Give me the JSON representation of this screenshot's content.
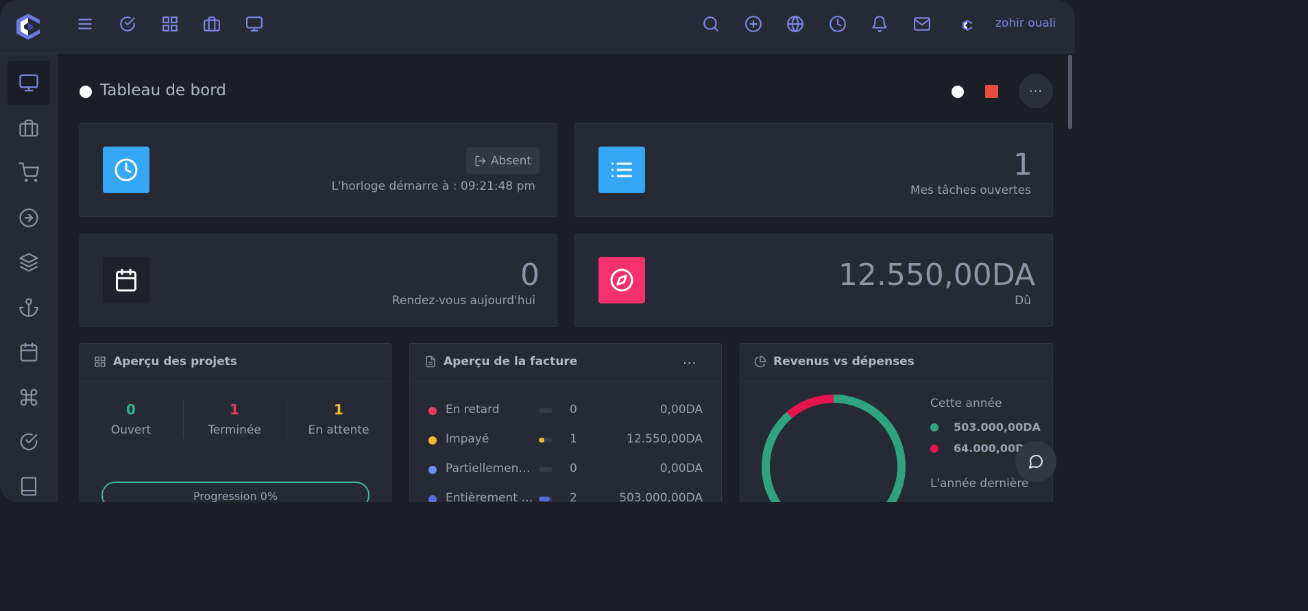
{
  "topbar": {
    "icons_left": [
      "menu-icon",
      "check-circle-icon",
      "grid-icon",
      "briefcase-icon",
      "monitor-icon"
    ],
    "icons_right": [
      "search-icon",
      "plus-circle-icon",
      "globe-icon",
      "clock-icon",
      "bell-icon",
      "mail-icon"
    ],
    "user_name": "zohir ouali"
  },
  "sidebar": {
    "items": [
      "monitor-icon",
      "briefcase-icon",
      "cart-icon",
      "arrow-right-circle-icon",
      "layers-icon",
      "anchor-icon",
      "calendar-icon",
      "command-icon",
      "check-circle-icon",
      "book-icon"
    ],
    "active": "monitor-icon"
  },
  "page": {
    "title": "Tableau de bord",
    "more": "···"
  },
  "clock_card": {
    "button": "Absent",
    "text": "L'horloge démarre à : 09:21:48 pm"
  },
  "tasks_card": {
    "value": "1",
    "label": "Mes tâches ouvertes"
  },
  "appointments_card": {
    "value": "0",
    "label": "Rendez-vous aujourd'hui"
  },
  "due_card": {
    "value": "12.550,00DA",
    "label": "Dû"
  },
  "projects_panel": {
    "title": "Aperçu des projets",
    "stats": [
      {
        "value": "0",
        "label": "Ouvert",
        "color": "#2db38a"
      },
      {
        "value": "1",
        "label": "Terminée",
        "color": "#e8395e"
      },
      {
        "value": "1",
        "label": "En attente",
        "color": "#f5b82e"
      }
    ],
    "progress_label": "Progression 0%"
  },
  "invoice_panel": {
    "title": "Aperçu de la facture",
    "more": "···",
    "rows": [
      {
        "label": "En retard",
        "count": "0",
        "amount": "0,00DA",
        "color": "#e8395e",
        "fill": 0
      },
      {
        "label": "Impayé",
        "count": "1",
        "amount": "12.550,00DA",
        "color": "#f5b82e",
        "fill": 0.4
      },
      {
        "label": "Partiellement payé",
        "count": "0",
        "amount": "0,00DA",
        "color": "#6c8ef0",
        "fill": 0
      },
      {
        "label": "Entièrement payé",
        "count": "2",
        "amount": "503.000,00DA",
        "color": "#5a6ae0",
        "fill": 0.8
      }
    ]
  },
  "revenue_panel": {
    "title": "Revenus vs dépenses",
    "this_year_label": "Cette année",
    "income": "503.000,00DA",
    "expense": "64.000,00DA",
    "income_color": "#2ea37e",
    "expense_color": "#e8124e",
    "last_year_label": "L'année dernière",
    "donut": {
      "income": 503000,
      "expense": 64000
    }
  }
}
